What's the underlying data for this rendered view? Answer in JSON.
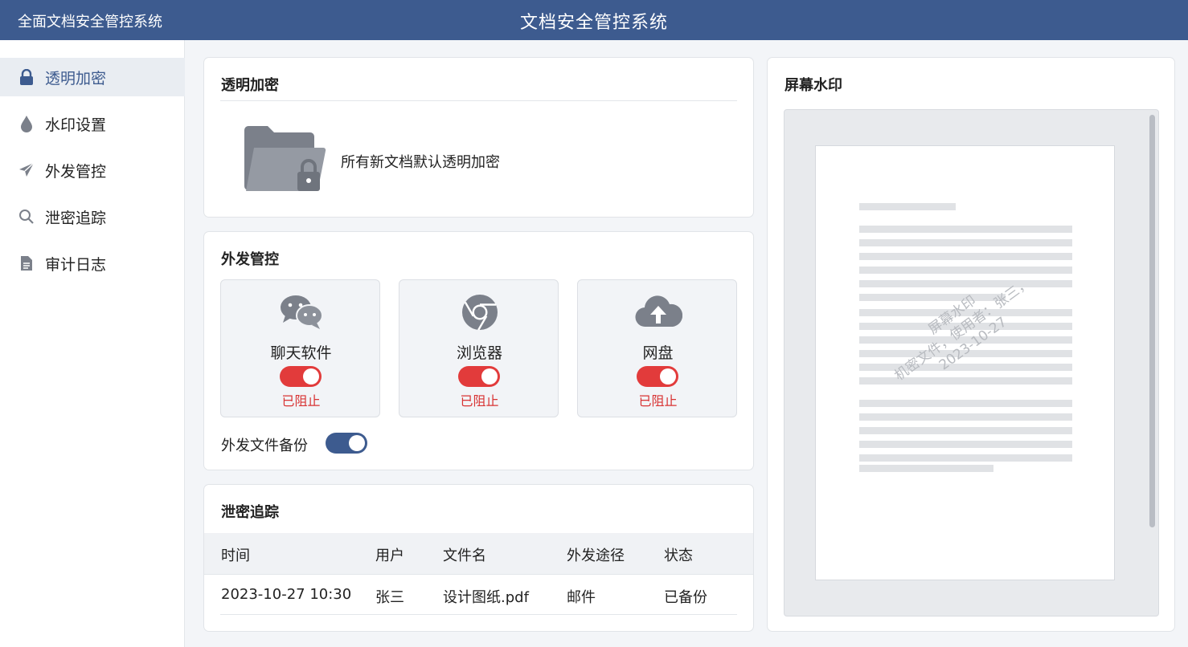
{
  "header": {
    "brand": "全面文档安全管控系统",
    "title": "文档安全管控系统"
  },
  "sidebar": {
    "items": [
      {
        "label": "透明加密",
        "icon": "lock-icon",
        "active": true
      },
      {
        "label": "水印设置",
        "icon": "droplet-icon",
        "active": false
      },
      {
        "label": "外发管控",
        "icon": "paper-plane-icon",
        "active": false
      },
      {
        "label": "泄密追踪",
        "icon": "search-icon",
        "active": false
      },
      {
        "label": "审计日志",
        "icon": "document-icon",
        "active": false
      }
    ]
  },
  "encryption": {
    "title": "透明加密",
    "description": "所有新文档默认透明加密"
  },
  "outbound": {
    "title": "外发管控",
    "channels": [
      {
        "label": "聊天软件",
        "icon": "chat-icon",
        "enabled": true,
        "status": "已阻止"
      },
      {
        "label": "浏览器",
        "icon": "browser-icon",
        "enabled": true,
        "status": "已阻止"
      },
      {
        "label": "网盘",
        "icon": "cloud-upload-icon",
        "enabled": true,
        "status": "已阻止"
      }
    ],
    "backup_label": "外发文件备份",
    "backup_enabled": true
  },
  "leak_tracking": {
    "title": "泄密追踪",
    "columns": [
      "时间",
      "用户",
      "文件名",
      "外发途径",
      "状态"
    ],
    "rows": [
      [
        "2023-10-27 10:30",
        "张三",
        "设计图纸.pdf",
        "邮件",
        "已备份"
      ]
    ]
  },
  "screen_watermark": {
    "title": "屏幕水印",
    "watermark_lines": [
      "屏幕水印",
      "机密文件，使用者：张三，",
      "2023-10-27"
    ]
  },
  "colors": {
    "primary": "#3d5b8f",
    "danger": "#e23b3b",
    "icon_gray": "#7b808a"
  }
}
